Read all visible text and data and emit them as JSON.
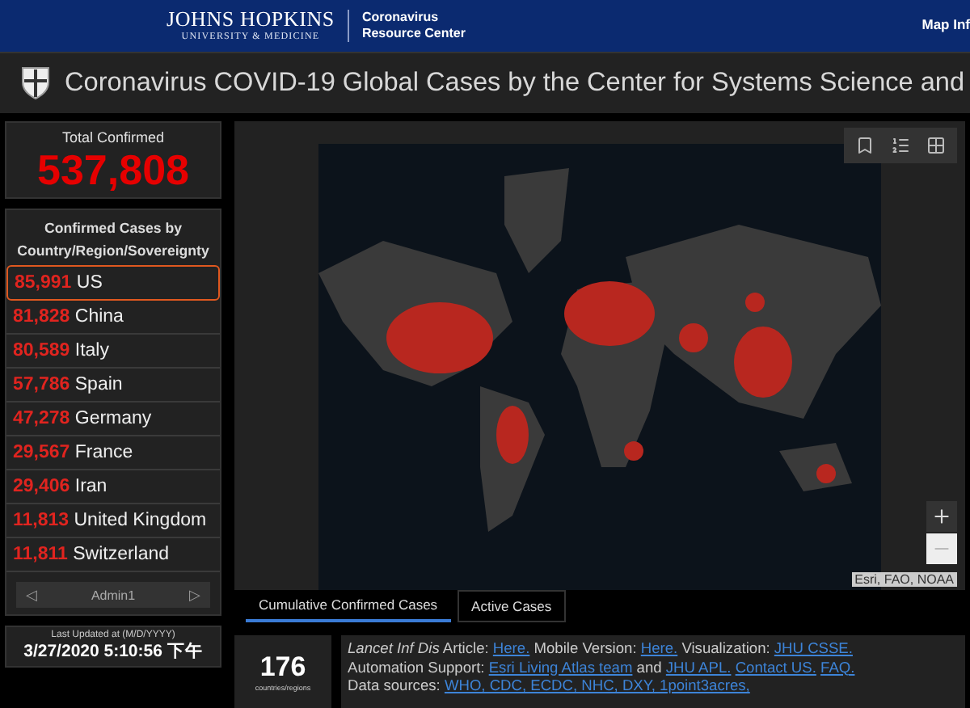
{
  "header": {
    "logo_title": "JOHNS HOPKINS",
    "logo_subtitle": "UNIVERSITY & MEDICINE",
    "center_lines": [
      "Coronavirus",
      "Resource Center"
    ],
    "link": "Map Inf"
  },
  "title_bar": {
    "title": "Coronavirus COVID-19 Global Cases by the Center for Systems Science and"
  },
  "total": {
    "label": "Total Confirmed",
    "value": "537,808"
  },
  "country_list": {
    "heading": "Confirmed Cases by Country/Region/Sovereignty",
    "items": [
      {
        "count": "85,991",
        "name": "US",
        "selected": true
      },
      {
        "count": "81,828",
        "name": "China",
        "selected": false
      },
      {
        "count": "80,589",
        "name": "Italy",
        "selected": false
      },
      {
        "count": "57,786",
        "name": "Spain",
        "selected": false
      },
      {
        "count": "47,278",
        "name": "Germany",
        "selected": false
      },
      {
        "count": "29,567",
        "name": "France",
        "selected": false
      },
      {
        "count": "29,406",
        "name": "Iran",
        "selected": false
      },
      {
        "count": "11,813",
        "name": "United Kingdom",
        "selected": false
      },
      {
        "count": "11,811",
        "name": "Switzerland",
        "selected": false
      }
    ],
    "pager": {
      "prev": "◁",
      "label": "Admin1",
      "next": "▷"
    }
  },
  "last_updated": {
    "label": "Last Updated at (M/D/YYYY)",
    "value": "3/27/2020 5:10:56 下午"
  },
  "map": {
    "attribution": "Esri, FAO, NOAA",
    "tabs": [
      {
        "label": "Cumulative Confirmed Cases",
        "selected": true
      },
      {
        "label": "Active Cases",
        "selected": false
      }
    ]
  },
  "countries": {
    "value": "176",
    "label": "countries/regions"
  },
  "info_lines": [
    [
      {
        "kind": "italic",
        "text": "Lancet Inf Dis"
      },
      {
        "kind": "text",
        "text": " Article: "
      },
      {
        "kind": "link",
        "text": "Here."
      },
      {
        "kind": "text",
        "text": " Mobile Version: "
      },
      {
        "kind": "link",
        "text": "Here."
      },
      {
        "kind": "text",
        "text": " Visualization: "
      },
      {
        "kind": "link",
        "text": "JHU CSSE."
      }
    ],
    [
      {
        "kind": "text",
        "text": "Automation Support: "
      },
      {
        "kind": "link",
        "text": "Esri Living Atlas team"
      },
      {
        "kind": "text",
        "text": " and "
      },
      {
        "kind": "link",
        "text": "JHU APL."
      },
      {
        "kind": "link",
        "text": "Contact US.",
        "spaced": true
      },
      {
        "kind": "link",
        "text": "FAQ.",
        "spaced": true
      }
    ],
    [
      {
        "kind": "text",
        "text": "Data sources: "
      },
      {
        "kind": "link",
        "text": "WHO, CDC, ECDC, NHC, DXY, 1point3acres,"
      }
    ]
  ]
}
